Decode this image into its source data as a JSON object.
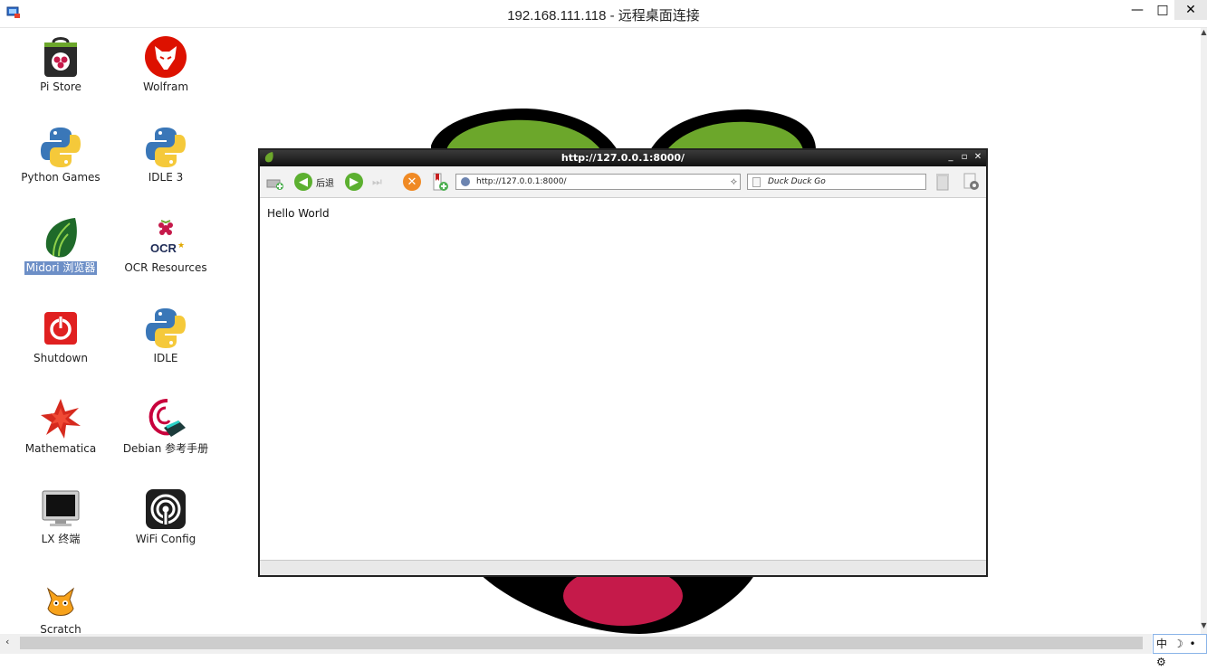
{
  "rdp": {
    "title": "192.168.111.118 - 远程桌面连接",
    "minimize": "—",
    "maximize": "□",
    "close": "✕"
  },
  "desktop_icons": [
    {
      "label": "Pi Store",
      "icon": "pi-store-icon"
    },
    {
      "label": "Wolfram",
      "icon": "wolfram-icon"
    },
    {
      "label": "Python Games",
      "icon": "python-icon"
    },
    {
      "label": "IDLE 3",
      "icon": "python-icon"
    },
    {
      "label": "Midori 浏览器",
      "icon": "midori-icon"
    },
    {
      "label": "OCR Resources",
      "icon": "ocr-icon"
    },
    {
      "label": "Shutdown",
      "icon": "power-icon"
    },
    {
      "label": "IDLE",
      "icon": "python-icon"
    },
    {
      "label": "Mathematica",
      "icon": "mathematica-icon"
    },
    {
      "label": "Debian 参考手册",
      "icon": "debian-icon"
    },
    {
      "label": "LX 终端",
      "icon": "terminal-icon"
    },
    {
      "label": "WiFi Config",
      "icon": "wifi-icon"
    },
    {
      "label": "Scratch",
      "icon": "scratch-icon"
    }
  ],
  "midori": {
    "title": "http://127.0.0.1:8000/",
    "back_label": "后退",
    "url": "http://127.0.0.1:8000/",
    "search_placeholder": "Duck Duck Go",
    "content": "Hello World"
  },
  "ime": {
    "lang": "中",
    "moon": "☽",
    "dot": "•",
    "gear": "⚙"
  },
  "colors": {
    "raspberry_leaf": "#6ca72b",
    "raspberry_berry": "#c51a4a",
    "selection": "#6d8fc7"
  }
}
